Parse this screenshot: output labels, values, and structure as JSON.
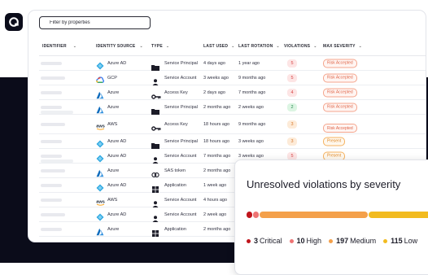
{
  "filter": {
    "placeholder": "Filter by properties"
  },
  "columns": {
    "identifier": "IDENTIFIER",
    "identity_source": "IDENTITY SOURCE",
    "type": "TYPE",
    "last_used": "LAST USED",
    "last_rotation": "LAST ROTATION",
    "violations": "VIOLATIONS",
    "max_severity": "MAX SEVERITY"
  },
  "rows": [
    {
      "source": "Azure AD",
      "source_icon": "azure-ad-icon",
      "type": "Service Principal",
      "type_icon": "folder-icon",
      "last_used": "4 days ago",
      "last_rotation": "1 year ago",
      "violations": "5",
      "severity": "Risk Accepted"
    },
    {
      "source": "GCP",
      "source_icon": "gcp-icon",
      "type": "Service Account",
      "type_icon": "person-icon",
      "last_used": "3 weeks ago",
      "last_rotation": "9 months ago",
      "violations": "5",
      "severity": "Risk Accepted"
    },
    {
      "source": "Azure",
      "source_icon": "azure-icon",
      "type": "Access Key",
      "type_icon": "key-icon",
      "last_used": "2 days ago",
      "last_rotation": "7 months ago",
      "violations": "4",
      "severity": "Risk Accepted"
    },
    {
      "source": "Azure",
      "source_icon": "azure-icon",
      "type": "Service Principal",
      "type_icon": "folder-icon",
      "last_used": "2 months ago",
      "last_rotation": "2 weeks ago",
      "violations": "2",
      "severity": "Risk Accepted"
    },
    {
      "source": "AWS",
      "source_icon": "aws-icon",
      "type": "Access Key",
      "type_icon": "key-icon",
      "last_used": "18 hours ago",
      "last_rotation": "9 months ago",
      "violations": "3",
      "severity": "Risk Accepted"
    },
    {
      "source": "Azure AD",
      "source_icon": "azure-ad-icon",
      "type": "Service Principal",
      "type_icon": "folder-icon",
      "last_used": "18 hours ago",
      "last_rotation": "3 weeks ago",
      "violations": "3",
      "severity": "Present"
    },
    {
      "source": "Azure AD",
      "source_icon": "azure-ad-icon",
      "type": "Service Account",
      "type_icon": "person-icon",
      "last_used": "7 months ago",
      "last_rotation": "3 weeks ago",
      "violations": "5",
      "severity": "Present"
    },
    {
      "source": "Azure",
      "source_icon": "azure-icon",
      "type": "SAS token",
      "type_icon": "link-icon",
      "last_used": "2 months ago",
      "last_rotation": "",
      "violations": "",
      "severity": ""
    },
    {
      "source": "Azure AD",
      "source_icon": "azure-ad-icon",
      "type": "Application",
      "type_icon": "grid-icon",
      "last_used": "1 week ago",
      "last_rotation": "",
      "violations": "",
      "severity": ""
    },
    {
      "source": "AWS",
      "source_icon": "aws-icon",
      "type": "Service Account",
      "type_icon": "person-icon",
      "last_used": "4 hours ago",
      "last_rotation": "",
      "violations": "",
      "severity": ""
    },
    {
      "source": "Azure AD",
      "source_icon": "azure-ad-icon",
      "type": "Service Account",
      "type_icon": "person-icon",
      "last_used": "2 week ago",
      "last_rotation": "",
      "violations": "",
      "severity": ""
    },
    {
      "source": "Azure",
      "source_icon": "azure-icon",
      "type": "Application",
      "type_icon": "grid-icon",
      "last_used": "2 months ago",
      "last_rotation": "",
      "violations": "",
      "severity": ""
    }
  ],
  "card": {
    "title": "Unresolved violations by severity",
    "segments": [
      {
        "label": "Critical",
        "count": "3",
        "value": 3,
        "color": "#c0151c"
      },
      {
        "label": "High",
        "count": "10",
        "value": 10,
        "color": "#ee7474"
      },
      {
        "label": "Medium",
        "count": "197",
        "value": 197,
        "color": "#f4a04a"
      },
      {
        "label": "Low",
        "count": "115",
        "value": 115,
        "color": "#f2bb1f"
      }
    ]
  },
  "colors": {
    "dark_bg": "#0b0c1a",
    "violation_red": "#fde5e5",
    "violation_orange": "#fdebd8",
    "violation_green": "#dcf5e3",
    "severity_border": "#f4a58d",
    "present_border": "#f5b260"
  }
}
